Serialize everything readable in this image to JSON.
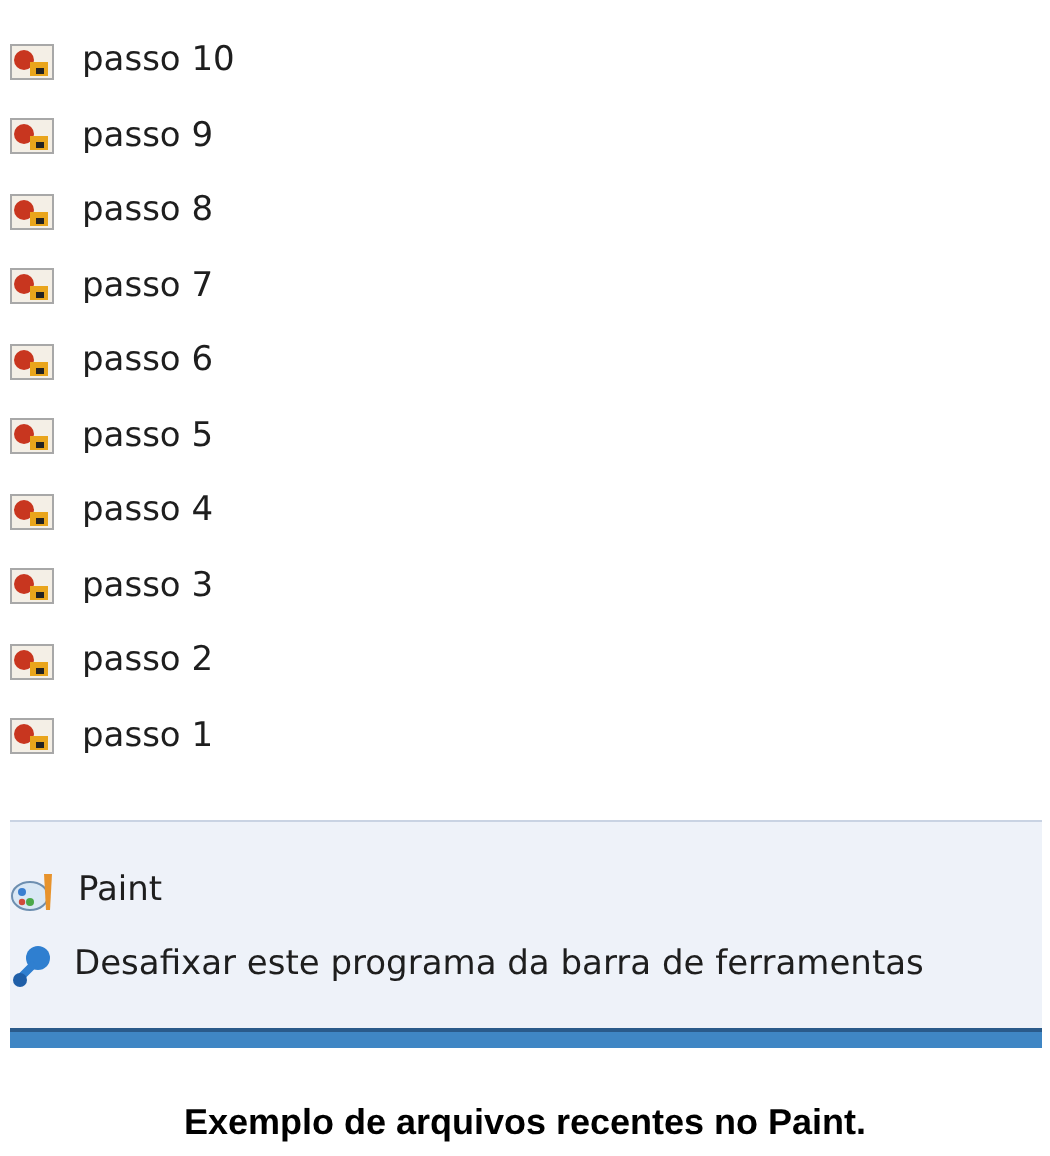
{
  "recent_items": [
    {
      "label": "passo 10"
    },
    {
      "label": "passo 9"
    },
    {
      "label": "passo 8"
    },
    {
      "label": "passo 7"
    },
    {
      "label": "passo 6"
    },
    {
      "label": "passo 5"
    },
    {
      "label": "passo 4"
    },
    {
      "label": "passo 3"
    },
    {
      "label": "passo 2"
    },
    {
      "label": "passo 1"
    }
  ],
  "tasks": [
    {
      "kind": "app",
      "label": "Paint"
    },
    {
      "kind": "unpin",
      "label": "Desafixar este programa da barra de ferramentas"
    }
  ],
  "caption": "Exemplo de arquivos recentes no Paint."
}
